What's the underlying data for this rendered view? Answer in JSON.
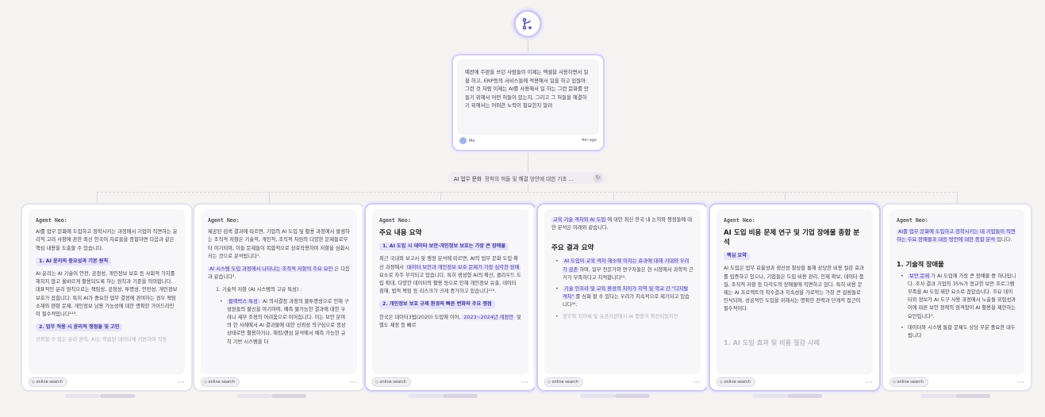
{
  "prompt": {
    "text": "예전에 주판을 쓰던 사람들이 이제는 엑셀을 사용하면서 일을 하고, ERP등의 서비스들에 적용해서 일을 하고 있잖아. 그런 것 처럼 이제는 AI를 사용해서 일 하는 그런 문화를 만들기 위해서 어떤 허들이 있는지, 그리고 그 허들을 해결하기 위해서는 어떠한 노력이 필요한지 알려",
    "author": "Me",
    "time": "4m ago"
  },
  "branch_pill": {
    "highlight": "AI 업무 문화",
    "text": "정착의 허들 및 해결 방안에 대한 기초 ..."
  },
  "cards": [
    {
      "agent": "Agent Neo:",
      "tag": "online search",
      "p1": "AI를 업무 문화에 도입하고 정착시키는 과정에서 기업이 직면하는 윤리적 고려 사항에 관한 최신 한국어 자료들을 종합하면 다음과 같은 핵심 내용을 도출할 수 있습니다.",
      "badge1": "1. AI 윤리의 중요성과 기본 원칙",
      "p2": "AI 윤리는 AI 기술이 안전, 공정성, 개인정보 보호 등 사회적 가치를 해치지 않고 올바르게 활용되도록 하는 원칙과 기준을 의미합니다. 대표적인 윤리 원칙으로는 책임성, 공정성, 투명성, 안전성, 개인정보 보호가 꼽힙니다. 특히 AI가 중요한 업무 결정에 관여하는 경우 책임 소재와 편향 문제, 개인정보 남용 가능성에 대한 명확한 가이드라인이 필수적입니다¹²³.",
      "badge2": "2. 업무 적용 시 윤리적 쟁점들 및 고민",
      "faded": "신뢰할 수 있는 윤리 원칙: AI는 학습된 데이터에 기반하여 작동"
    },
    {
      "agent": "Agent Neo:",
      "tag": "online search",
      "p1": "제공된 검색 결과에 따르면, 기업의 AI 도입 및 활용 과정에서 발생하는 조직적 저항은 기술적, 개인적, 조직적 차원의 다양한 문제들로부터 야기되며, 이들 문제들이 복합적으로 상호작용하며 저항을 심화시키는 것으로 분석됩니다¹.",
      "mark1": "AI 시스템 도입 과정에서 나타나는 조직적 저항의 주요 요인",
      "p1b": "은 다음과 같습니다².",
      "num1": "1. 기술적 저항 (AI 시스템의 고유 특성) :",
      "li1_mark": "블랙박스 특성",
      "li1": ": AI 의사결정 과정의 불투명성으로 인해 구성원들의 불신을 야기하며, 예측 불가능한 결과에 대한 우려나 세부 조정의 어려움으로 이어집니다. 이는 보안 분야의 한 사례에서 AI 결과물에 대한 신뢰성 의구심으로 정상 상태로만 활용하거나, 해킹/랜섬 분석에서 예측 가능한 규칙 기반 시스템을 더"
    },
    {
      "agent": "Agent Neo:",
      "tag": "online search",
      "title": "주요 내용 요약",
      "badge1": "1. AI 도입 시 데이터 보안·개인정보 보호는 가장 큰 장애물",
      "p1a": "최근 국내외 보고서 및 행정 분석에 따르면, AI의 업무 문화 도입·확산 과정에서",
      "mark1": "데이터 보안과 개인정보 보호 문제가 가장 심각한 장애",
      "p1b": "요소로 자주 부각되고 있습니다. 특히 생성형 AI의 확산, 클라우드 도입 확대, 다양한 데이터의 활용 등으로 인해 개인정보 유출, 데이터 침해, 법적 책임 등 리스크가 크게 증가하고 있습니다¹²³.",
      "badge2": "2. 개인정보 보호 규제 환경의 빠른 변화와 주요 쟁점",
      "p2a": "한국은 데이터3법(2020) 도입에 이어,",
      "mark2": "2023~2024년 개정안",
      "p2b": "및 별도 제정 등 빠르"
    },
    {
      "agent": "",
      "tag": "online search",
      "mark0": "교육 기술 격차와 AI 도입",
      "p0": "에 대한 최신 한국 내 논의와 쟁점들에 대한 분석은 아래와 같습니다.",
      "title": "주요 결과 요약",
      "li1_mark": "AI 도입이 교육 격차 해소에 미치는 효과에 대해 기대와 우려가 공존",
      "li1": "하며, 일부 전문가와 연구자들은 현 시점에서 과학적 근거가 부족하다고 지적합니다¹².",
      "li2_mark": "기술 인프라 및 교육 환경의 차이가 지역 및 학교 간 \"디지털 격차\"",
      "li2": "를 심화 할 수 있다는 우려가 지속적으로 제기되고 있습니다³⁴.",
      "faded": "정부와 지자체 및 유관기관에서 AI 활용이 확산되었지만"
    },
    {
      "agent": "Agent Neo:",
      "tag": "online search",
      "title": "AI 도입 비용 문제 연구 및 기업 장애물 종합 분석",
      "badge1": "핵심 요약",
      "p1": "AI 도입은 업무 효율성과 생산성 향상을 통해 상당한 비용 절감 효과를 입증하고 있으나, 기업들은 도입 비용 관리, 인재 확보, 데이터 품질, 조직적 저항 등 다각도의 장애물에 직면하고 있다. 특히 비용 문제는 AI 프로젝트의 착수결과 지속성을 가로막는 가장 큰 걸림돌로 인식되며, 성공적인 도입을 위해서는 명확한 전략과 단계적 접근이 필수적이다.",
      "faded": "1. AI 도입 효과 및 비용 절감 사례"
    },
    {
      "agent": "Agent Neo:",
      "tag": "online search",
      "mark0": "AI를 업무 문화에 도입하고 정착시키는 데 기업들이 직면하는 주요 장애물과 대응 방안에 대한 종합 분석",
      "p0": "입니다.",
      "title": "1. 기술적 장애물",
      "li1_mark": "보안 문제",
      "li1": "가 AI 도입에 가장 큰 장애물 중 하나입니다. 조사 결과 기업의 35%가 정교한 보안 프로그램 부족을 AI 도입 제한 요소로 꼽았습니다. 주요 데이터와 정보가 AI 도구 사용 과정에서 노출될 위험성과 이에 따른 보안 정책의 엄격함이 AI 활용을 제한하는 요인입니다¹.",
      "li2": "데이터와 시스템 통합 문제도 상당 부분 중요한 대두됩니다"
    }
  ]
}
